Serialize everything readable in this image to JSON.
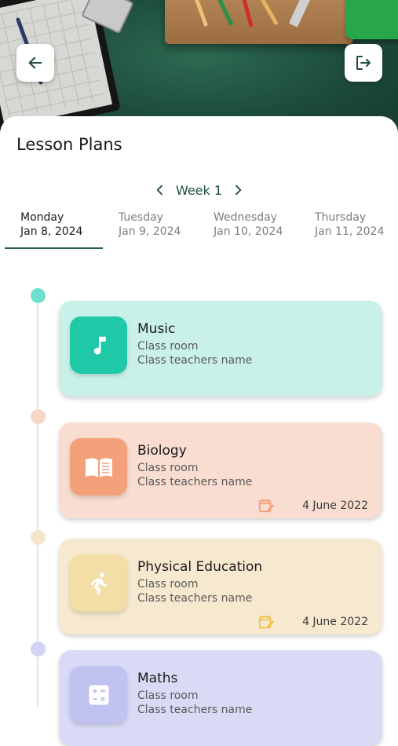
{
  "header": {
    "back_icon": "arrow-left-icon",
    "logout_icon": "logout-icon"
  },
  "page": {
    "title": "Lesson Plans"
  },
  "week": {
    "label": "Week 1",
    "prev_icon": "chevron-left-icon",
    "next_icon": "chevron-right-icon",
    "accent": "#1e4d3f"
  },
  "days": [
    {
      "name": "Monday",
      "date": "Jan 8, 2024",
      "active": true
    },
    {
      "name": "Tuesday",
      "date": "Jan 9, 2024",
      "active": false
    },
    {
      "name": "Wednesday",
      "date": "Jan 10, 2024",
      "active": false
    },
    {
      "name": "Thursday",
      "date": "Jan 11, 2024",
      "active": false
    }
  ],
  "lessons": [
    {
      "subject": "Music",
      "room": "Class room",
      "teacher": "Class teachers name",
      "date": "",
      "icon": "music-note-icon",
      "card_color": "#c9f1ea",
      "icon_color": "#1fc9a8",
      "dot_color": "#6ee0cd"
    },
    {
      "subject": "Biology",
      "room": "Class room",
      "teacher": "Class teachers name",
      "date": "4 June 2022",
      "icon": "book-icon",
      "card_color": "#f8ddd0",
      "icon_color": "#f4a07a",
      "dot_color": "#f6d6c7",
      "cal_color": "#f4a07a"
    },
    {
      "subject": "Physical Education",
      "room": "Class room",
      "teacher": "Class teachers name",
      "date": "4 June 2022",
      "icon": "running-icon",
      "card_color": "#f6e9d0",
      "icon_color": "#f3dea6",
      "dot_color": "#f4e6cc",
      "cal_color": "#f2c14c"
    },
    {
      "subject": "Maths",
      "room": "Class room",
      "teacher": "Class teachers name",
      "date": "",
      "icon": "calculator-icon",
      "card_color": "#d9daf6",
      "icon_color": "#c0c2f0",
      "dot_color": "#d3d4f5"
    }
  ]
}
